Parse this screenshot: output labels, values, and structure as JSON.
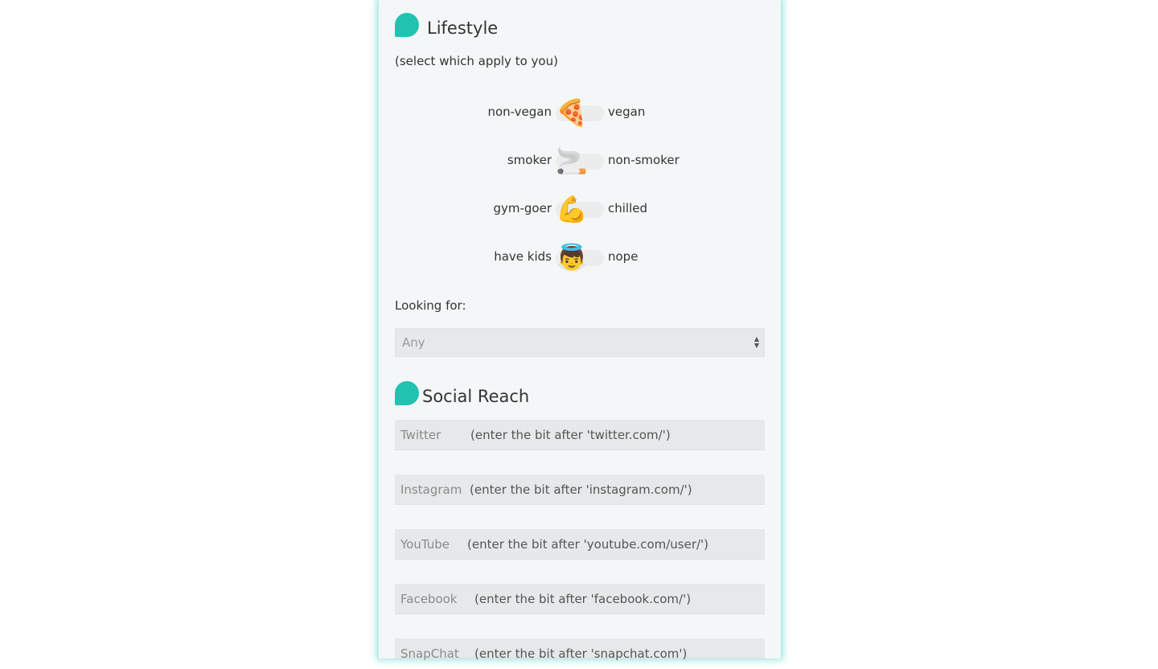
{
  "lifestyle": {
    "title": "Lifestyle",
    "subtitle": "(select which apply to you)",
    "toggles": [
      {
        "left": "non-vegan",
        "right": "vegan",
        "icon": "pizza-icon",
        "emoji": "🍕"
      },
      {
        "left": "smoker",
        "right": "non-smoker",
        "icon": "cigarette-icon",
        "emoji": "🚬"
      },
      {
        "left": "gym-goer",
        "right": "chilled",
        "icon": "flexed-biceps-icon",
        "emoji": "💪"
      },
      {
        "left": "have kids",
        "right": "nope",
        "icon": "baby-angel-icon",
        "emoji": "👼"
      }
    ],
    "looking_for_label": "Looking for:",
    "looking_for_value": "Any"
  },
  "social": {
    "title": "Social Reach",
    "fields": [
      {
        "label": "Twitter",
        "placeholder": "(enter the bit after 'twitter.com/')"
      },
      {
        "label": "Instagram",
        "placeholder": "(enter the bit after 'instagram.com/')"
      },
      {
        "label": "YouTube",
        "placeholder": "(enter the bit after 'youtube.com/user/')"
      },
      {
        "label": "Facebook",
        "placeholder": "(enter the bit after 'facebook.com/')"
      },
      {
        "label": "SnapChat",
        "placeholder": "(enter the bit after 'snapchat.com')"
      }
    ]
  },
  "colors": {
    "accent": "#20c3b0",
    "panel_bg": "#f4f7f7",
    "field_bg": "#e5e9e9"
  }
}
